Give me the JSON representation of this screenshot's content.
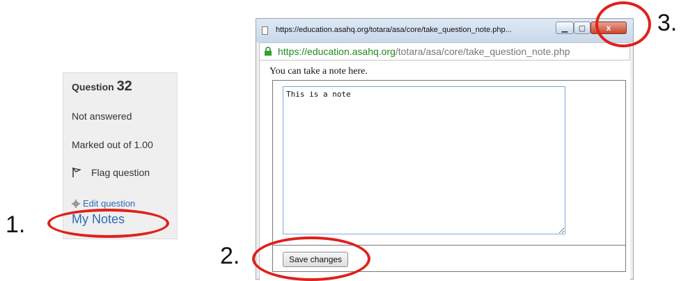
{
  "steps": {
    "one": "1.",
    "two": "2.",
    "three": "3."
  },
  "question_panel": {
    "title_prefix": "Question",
    "number": "32",
    "status": "Not answered",
    "marked": "Marked out of 1.00",
    "flag_label": "Flag question",
    "edit_label": "Edit question",
    "notes_link": "My Notes"
  },
  "popup": {
    "window_title": "https://education.asahq.org/totara/asa/core/take_question_note.php...",
    "address_secure": "https://",
    "address_domain": "education.asahq.org",
    "address_path": "/totara/asa/core/take_question_note.php",
    "note_label": "You can take a note here.",
    "note_text": "This is a note",
    "save_label": "Save changes",
    "close_glyph": "x"
  },
  "colors": {
    "annotation": "#e0201b",
    "link": "#2a6bb5",
    "secure_green": "#218a21"
  },
  "icons": [
    "flag-icon",
    "gear-icon",
    "page-icon",
    "lock-icon",
    "minimize-icon",
    "maximize-icon",
    "close-icon"
  ]
}
